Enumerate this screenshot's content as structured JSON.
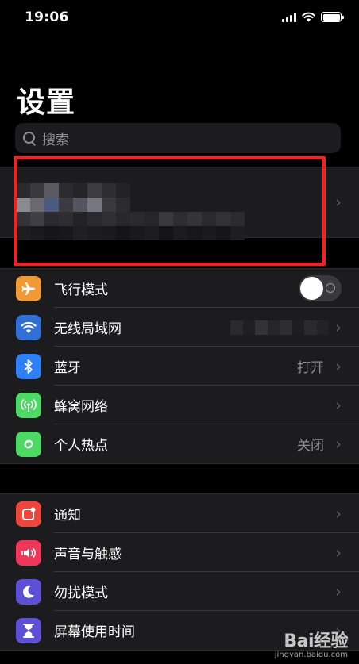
{
  "status_bar": {
    "time": "19:06"
  },
  "header": {
    "title": "设置"
  },
  "search": {
    "placeholder": "搜索"
  },
  "network_group": {
    "items": [
      {
        "label": "飞行模式",
        "value": "",
        "icon": "airplane-icon",
        "color": "#f09a37",
        "toggle": false
      },
      {
        "label": "无线局域网",
        "value": "",
        "icon": "wifi-icon",
        "color": "#2f6fd6"
      },
      {
        "label": "蓝牙",
        "value": "打开",
        "icon": "bluetooth-icon",
        "color": "#2f7ff6"
      },
      {
        "label": "蜂窝网络",
        "value": "",
        "icon": "cellular-icon",
        "color": "#4cd964"
      },
      {
        "label": "个人热点",
        "value": "关闭",
        "icon": "hotspot-icon",
        "color": "#4cd964"
      }
    ]
  },
  "system_group": {
    "items": [
      {
        "label": "通知",
        "icon": "notification-icon",
        "color": "#f0453a"
      },
      {
        "label": "声音与触感",
        "icon": "sound-icon",
        "color": "#f0365a"
      },
      {
        "label": "勿扰模式",
        "icon": "moon-icon",
        "color": "#5d4fd6"
      },
      {
        "label": "屏幕使用时间",
        "icon": "hourglass-icon",
        "color": "#5d4fd6"
      }
    ]
  },
  "watermark": {
    "brand": "Bai经验",
    "url": "jingyan.baidu.com"
  }
}
